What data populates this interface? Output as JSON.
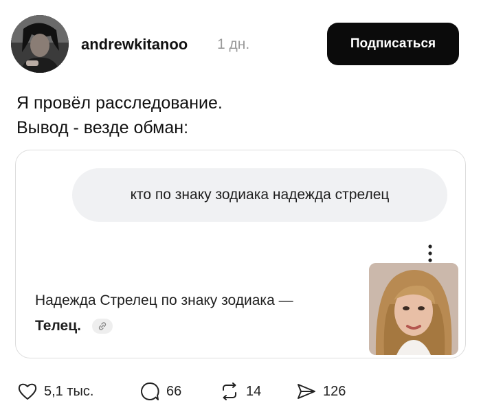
{
  "post": {
    "author": "andrewkitanoo",
    "time": "1 дн.",
    "follow_label": "Подписаться",
    "text_lines": [
      "Я провёл расследование.",
      "Вывод - везде обман:"
    ]
  },
  "card": {
    "query": "кто по знаку зодиака надежда стрелец",
    "answer_prefix": "Надежда Стрелец по знаку зодиака —",
    "answer_bold": "Телец."
  },
  "actions": {
    "likes": "5,1 тыс.",
    "comments": "66",
    "reposts": "14",
    "shares": "126"
  },
  "icons": {
    "like": "heart-icon",
    "comment": "comment-bubble-icon",
    "repost": "repost-icon",
    "share": "send-icon",
    "more": "more-vertical-icon",
    "link": "link-icon"
  },
  "colors": {
    "follow_bg": "#0b0b0b",
    "muted": "#9a9a9a",
    "bubble": "#f0f1f3"
  }
}
